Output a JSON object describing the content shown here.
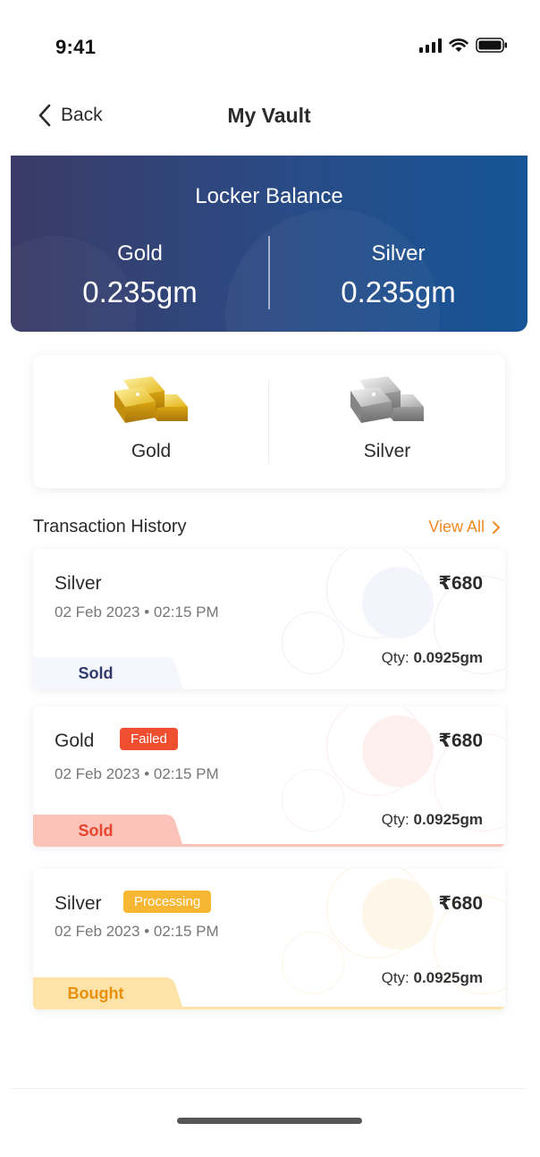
{
  "status_bar": {
    "time": "9:41"
  },
  "header": {
    "back_label": "Back",
    "title": "My Vault"
  },
  "balance": {
    "title": "Locker Balance",
    "gold": {
      "label": "Gold",
      "value": "0.235gm"
    },
    "silver": {
      "label": "Silver",
      "value": "0.235gm"
    },
    "colors": {
      "start": "#3a3b66",
      "end": "#155597"
    }
  },
  "metals": {
    "gold": {
      "label": "Gold",
      "icon": "gold-bars-icon"
    },
    "silver": {
      "label": "Silver",
      "icon": "silver-bars-icon"
    }
  },
  "transactions": {
    "heading": "Transaction History",
    "view_all": "View All",
    "items": [
      {
        "metal": "Silver",
        "badge": "",
        "date": "02 Feb 2023 • 02:15 PM",
        "amount": "₹680",
        "qty_label": "Qty:",
        "qty_value": "0.0925gm",
        "type": "Sold",
        "type_color": "#2f3a6b",
        "tab_color": "#f4f6fb",
        "accent": ""
      },
      {
        "metal": "Gold",
        "badge": "Failed",
        "badge_color": "#ef4e2f",
        "date": "02 Feb 2023 • 02:15 PM",
        "amount": "₹680",
        "qty_label": "Qty:",
        "qty_value": "0.0925gm",
        "type": "Sold",
        "type_color": "#e9452e",
        "tab_color": "#fbc3b9",
        "accent": "#fbc3b9"
      },
      {
        "metal": "Silver",
        "badge": "Processing",
        "badge_color": "#f7b733",
        "date": "02 Feb 2023 • 02:15 PM",
        "amount": "₹680",
        "qty_label": "Qty:",
        "qty_value": "0.0925gm",
        "type": "Bought",
        "type_color": "#e8900e",
        "tab_color": "#fde3a8",
        "accent": "#fde3a8"
      }
    ]
  },
  "accent_color": "#f08a24"
}
